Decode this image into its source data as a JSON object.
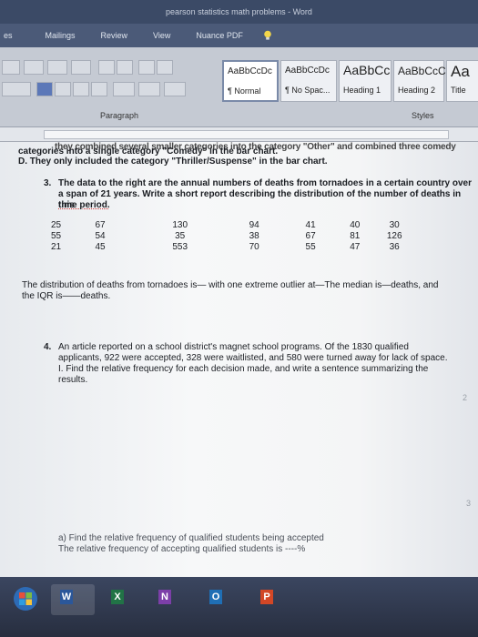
{
  "window": {
    "title": "pearson statistics math problems - Word"
  },
  "ribbon_tabs": [
    {
      "label": "es"
    },
    {
      "label": "Mailings"
    },
    {
      "label": "Review"
    },
    {
      "label": "View"
    },
    {
      "label": "Nuance PDF"
    }
  ],
  "ribbon": {
    "styles": [
      {
        "sample": "AaBbCcDc",
        "name": "¶ Normal",
        "selected": true
      },
      {
        "sample": "AaBbCcDc",
        "name": "¶ No Spac...",
        "selected": false
      },
      {
        "sample": "AaBbCc",
        "name": "Heading 1",
        "selected": false
      },
      {
        "sample": "AaBbCcC",
        "name": "Heading 2",
        "selected": false
      },
      {
        "sample": "Aa",
        "name": "Title",
        "selected": false
      }
    ],
    "paragraph_label": "Paragraph",
    "styles_label": "Styles"
  },
  "document": {
    "clipped_line": "they combined several smaller categories into the category \"Other\" and combined three comedy",
    "line_c": "categories into a single category \"Comedy\" in the bar chart.",
    "line_d": "D. They only included the category \"Thriller/Suspense\" in the bar chart.",
    "q3": {
      "number": "3.",
      "text1": "The data to the right are the annual numbers of deaths from tornadoes in a certain country over",
      "text2": "a span of 21 years. Write a short report describing the distribution of the number of deaths in this",
      "text3": "time period.",
      "rows": [
        [
          "25",
          "67",
          "130",
          "94",
          "41",
          "40",
          "30"
        ],
        [
          "55",
          "54",
          "35",
          "38",
          "67",
          "81",
          "126"
        ],
        [
          "21",
          "45",
          "553",
          "70",
          "55",
          "47",
          "36"
        ]
      ],
      "answer1": "The distribution of deaths from tornadoes is— with one extreme outlier at—The median is—deaths, and",
      "answer2": "the IQR is——deaths."
    },
    "q4": {
      "number": "4.",
      "text1": "An article reported on a school district's magnet school programs. Of the 1830 qualified",
      "text2": "applicants, 922 were accepted, 328 were waitlisted, and 580 were turned away for lack of space.",
      "text3": "I. Find the relative frequency for each decision made, and write a sentence summarizing the",
      "text4": "results.",
      "part_a1": "a)  Find the relative frequency of qualified students being accepted",
      "part_a2": "The relative frequency of accepting qualified students is ----%"
    },
    "page_numbers": [
      "2",
      "3"
    ]
  },
  "taskbar": {
    "apps": [
      {
        "letter": "W",
        "color": "#2b579a"
      },
      {
        "letter": "X",
        "color": "#217346"
      },
      {
        "letter": "N",
        "color": "#7c3fa8"
      },
      {
        "letter": "O",
        "color": "#1f6fb5"
      },
      {
        "letter": "P",
        "color": "#d24726"
      }
    ]
  }
}
